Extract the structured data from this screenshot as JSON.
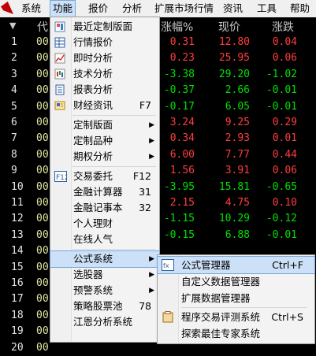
{
  "menubar": {
    "items": [
      "系统",
      "功能",
      "报价",
      "分析",
      "扩展市场行情",
      "资讯",
      "工具",
      "帮助"
    ]
  },
  "table": {
    "headers": {
      "code": "代",
      "pct": "涨幅%",
      "price": "现价",
      "change": "涨跌"
    },
    "rows": [
      {
        "idx": "1",
        "code": "00",
        "pct": "0.31",
        "price": "12.80",
        "change": "0.04",
        "dir": "up"
      },
      {
        "idx": "2",
        "code": "00",
        "pct": "0.23",
        "price": "25.95",
        "change": "0.06",
        "dir": "up"
      },
      {
        "idx": "3",
        "code": "00",
        "pct": "-3.38",
        "price": "29.20",
        "change": "-1.02",
        "dir": "down"
      },
      {
        "idx": "4",
        "code": "00",
        "pct": "-0.37",
        "price": "2.66",
        "change": "-0.01",
        "dir": "down"
      },
      {
        "idx": "5",
        "code": "00",
        "pct": "-0.17",
        "price": "6.05",
        "change": "-0.01",
        "dir": "down"
      },
      {
        "idx": "6",
        "code": "00",
        "pct": "3.24",
        "price": "9.25",
        "change": "0.29",
        "dir": "up"
      },
      {
        "idx": "7",
        "code": "00",
        "pct": "0.34",
        "price": "2.93",
        "change": "0.01",
        "dir": "up"
      },
      {
        "idx": "8",
        "code": "00",
        "pct": "6.00",
        "price": "7.77",
        "change": "0.44",
        "dir": "up"
      },
      {
        "idx": "9",
        "code": "00",
        "pct": "1.56",
        "price": "3.91",
        "change": "0.06",
        "dir": "up"
      },
      {
        "idx": "10",
        "code": "00",
        "pct": "-3.95",
        "price": "15.81",
        "change": "-0.65",
        "dir": "down"
      },
      {
        "idx": "11",
        "code": "00",
        "pct": "2.15",
        "price": "4.75",
        "change": "0.10",
        "dir": "up"
      },
      {
        "idx": "12",
        "code": "00",
        "pct": "-1.15",
        "price": "10.29",
        "change": "-0.12",
        "dir": "down"
      },
      {
        "idx": "13",
        "code": "00",
        "pct": "-0.15",
        "price": "6.88",
        "change": "-0.01",
        "dir": "down"
      },
      {
        "idx": "14",
        "code": "00",
        "pct": "",
        "price": "",
        "change": "",
        "dir": "up"
      },
      {
        "idx": "15",
        "code": "00",
        "pct": "",
        "price": "",
        "change": "",
        "dir": "up"
      },
      {
        "idx": "16",
        "code": "00",
        "pct": "",
        "price": "",
        "change": "",
        "dir": "up"
      },
      {
        "idx": "17",
        "code": "00",
        "pct": "",
        "price": "",
        "change": "",
        "dir": "up"
      },
      {
        "idx": "18",
        "code": "00",
        "pct": "",
        "price": "",
        "change": "",
        "dir": "up"
      },
      {
        "idx": "19",
        "code": "00",
        "pct": "",
        "price": "",
        "change": "",
        "dir": "up"
      },
      {
        "idx": "20",
        "code": "00",
        "pct": "",
        "price": "",
        "change": "",
        "dir": "up"
      }
    ]
  },
  "function_menu": {
    "items": [
      {
        "label": "最近定制版面",
        "shortcut": "",
        "icon": "layout-icon"
      },
      {
        "label": "行情报价",
        "shortcut": "",
        "icon": "quote-table-icon"
      },
      {
        "label": "即时分析",
        "shortcut": "",
        "icon": "line-chart-icon"
      },
      {
        "label": "技术分析",
        "shortcut": "",
        "icon": "candlestick-icon"
      },
      {
        "label": "报表分析",
        "shortcut": "",
        "icon": "report-icon"
      },
      {
        "label": "财经资讯",
        "shortcut": "F7",
        "icon": "news-icon"
      },
      {
        "label": "定制版面",
        "shortcut": "",
        "submenu": true
      },
      {
        "label": "定制品种",
        "shortcut": "",
        "submenu": true
      },
      {
        "label": "期权分析",
        "shortcut": "",
        "submenu": true
      },
      {
        "label": "交易委托",
        "shortcut": "F12",
        "icon": "f12-icon"
      },
      {
        "label": "金融计算器",
        "shortcut": "31"
      },
      {
        "label": "金融记事本",
        "shortcut": "32"
      },
      {
        "label": "个人理财",
        "shortcut": ""
      },
      {
        "label": "在线人气",
        "shortcut": ""
      },
      {
        "label": "公式系统",
        "shortcut": "",
        "submenu": true
      },
      {
        "label": "选股器",
        "shortcut": "",
        "submenu": true
      },
      {
        "label": "预警系统",
        "shortcut": "",
        "submenu": true
      },
      {
        "label": "策略股票池",
        "shortcut": "78"
      },
      {
        "label": "江恩分析系统",
        "shortcut": ""
      }
    ]
  },
  "formula_submenu": {
    "items": [
      {
        "label": "公式管理器",
        "shortcut": "Ctrl+F",
        "icon": "formula-icon"
      },
      {
        "label": "自定义数据管理器",
        "shortcut": ""
      },
      {
        "label": "扩展数据管理器",
        "shortcut": ""
      },
      {
        "label": "程序交易评测系统",
        "shortcut": "Ctrl+S",
        "icon": "clipboard-icon"
      },
      {
        "label": "探索最佳专家系统",
        "shortcut": ""
      }
    ]
  }
}
